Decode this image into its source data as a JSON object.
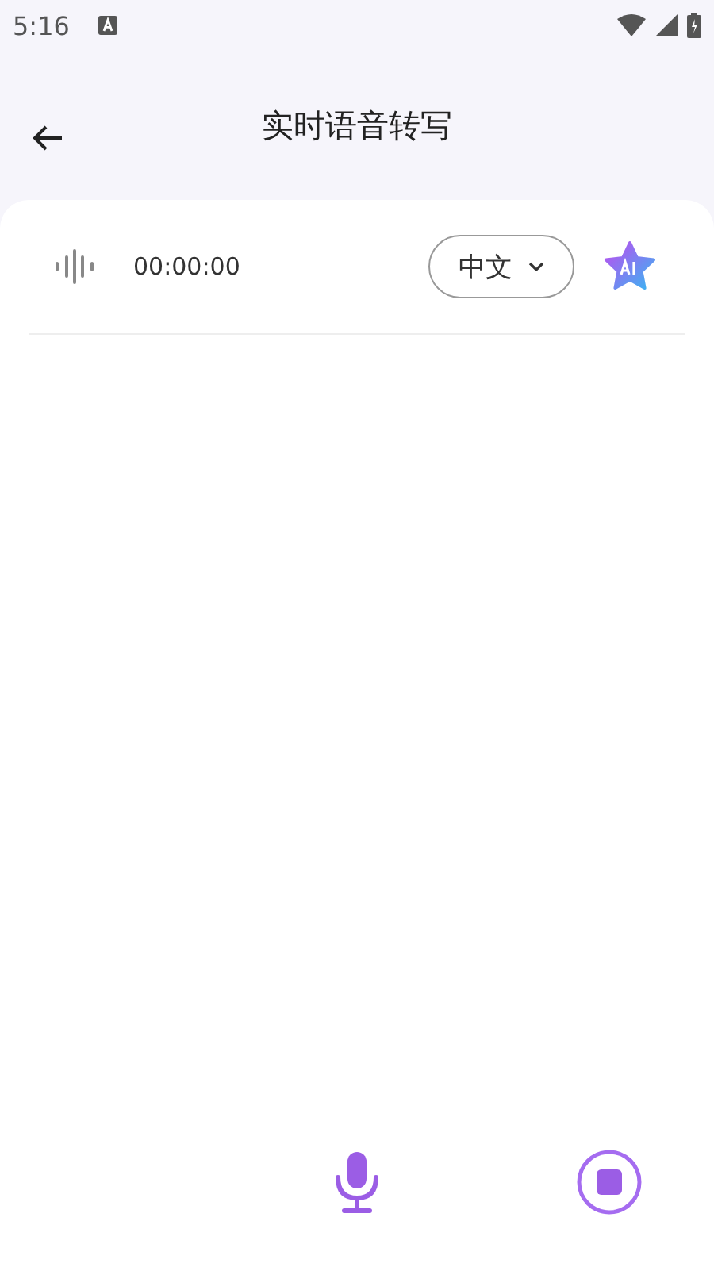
{
  "status_bar": {
    "time": "5:16"
  },
  "header": {
    "title": "实时语音转写"
  },
  "recorder": {
    "elapsed": "00:00:00",
    "language": "中文"
  }
}
